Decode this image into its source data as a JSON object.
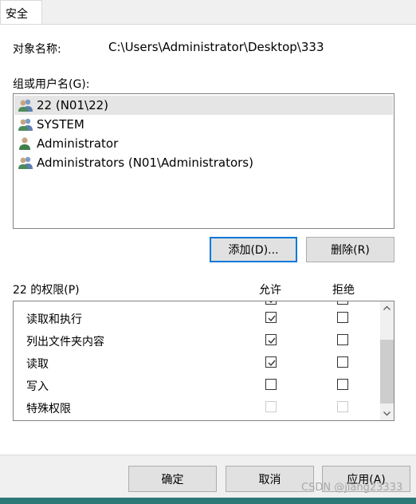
{
  "tab": {
    "label": "安全"
  },
  "object": {
    "label": "对象名称:",
    "value": "C:\\Users\\Administrator\\Desktop\\333"
  },
  "groups": {
    "label": "组或用户名(G):",
    "items": [
      {
        "name": "22 (N01\\22)",
        "icon": "group-icon",
        "selected": true
      },
      {
        "name": "SYSTEM",
        "icon": "group-icon",
        "selected": false
      },
      {
        "name": "Administrator",
        "icon": "user-icon",
        "selected": false
      },
      {
        "name": "Administrators (N01\\Administrators)",
        "icon": "group-icon",
        "selected": false
      }
    ]
  },
  "buttons": {
    "add": "添加(D)...",
    "remove": "删除(R)"
  },
  "permissions": {
    "label": "22 的权限(P)",
    "allow_header": "允许",
    "deny_header": "拒绝",
    "rows": [
      {
        "name": "读取和执行",
        "allow": true,
        "deny": false,
        "disabled": false
      },
      {
        "name": "列出文件夹内容",
        "allow": true,
        "deny": false,
        "disabled": false
      },
      {
        "name": "读取",
        "allow": true,
        "deny": false,
        "disabled": false
      },
      {
        "name": "写入",
        "allow": false,
        "deny": false,
        "disabled": false
      },
      {
        "name": "特殊权限",
        "allow": false,
        "deny": false,
        "disabled": true
      }
    ]
  },
  "footer": {
    "ok": "确定",
    "cancel": "取消",
    "apply": "应用(A)"
  },
  "watermark": "CSDN @jiang23333"
}
